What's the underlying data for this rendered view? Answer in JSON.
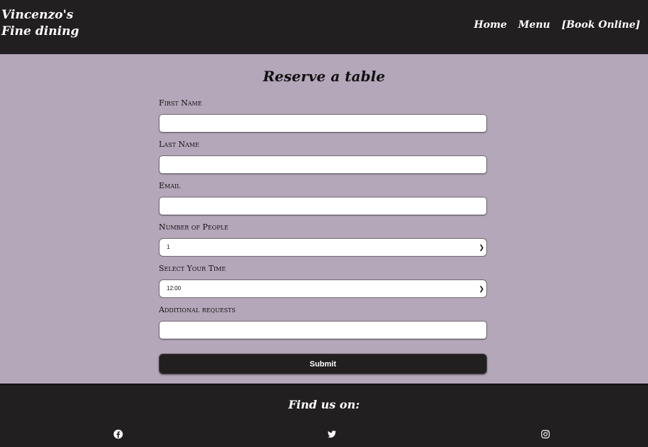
{
  "brand": {
    "line1": "Vincenzo's",
    "line2": "Fine dining"
  },
  "nav": {
    "home": "Home",
    "menu": "Menu",
    "book": "Book Online"
  },
  "form": {
    "title": "Reserve a table",
    "first_name_label": "First Name",
    "last_name_label": "Last Name",
    "email_label": "Email",
    "people_label": "Number of People",
    "people_value": "1",
    "time_label": "Select Your Time",
    "time_value": "12:00",
    "requests_label": "Additional requests",
    "submit_label": "Submit"
  },
  "footer": {
    "find_us": "Find us on:",
    "icons": [
      "facebook-icon",
      "twitter-icon",
      "instagram-icon"
    ]
  },
  "colors": {
    "header_bg": "#221f20",
    "page_bg": "#b4a7ba"
  }
}
